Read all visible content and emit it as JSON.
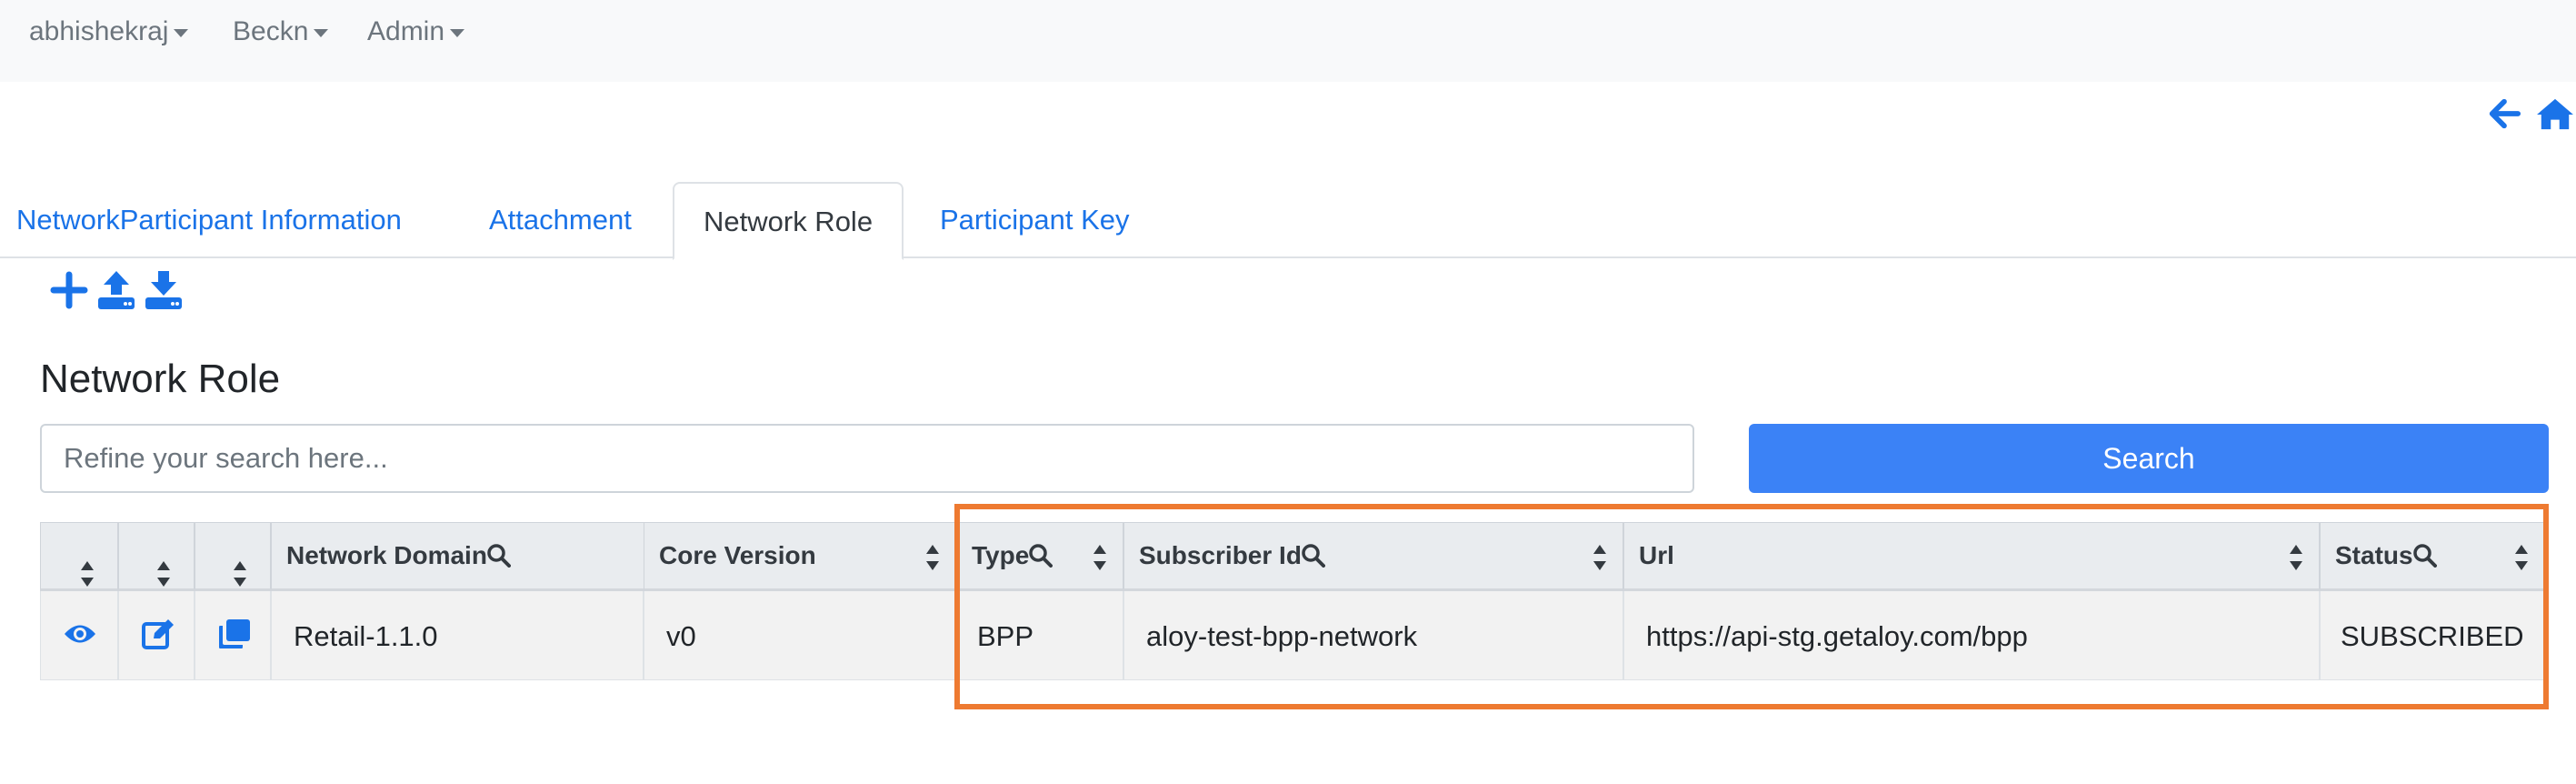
{
  "navbar": {
    "items": [
      {
        "label": "abhishekraj"
      },
      {
        "label": "Beckn"
      },
      {
        "label": "Admin"
      }
    ]
  },
  "tabs": [
    {
      "label": "NetworkParticipant Information",
      "active": false
    },
    {
      "label": "Attachment",
      "active": false
    },
    {
      "label": "Network Role",
      "active": true
    },
    {
      "label": "Participant Key",
      "active": false
    }
  ],
  "page": {
    "title": "Network Role"
  },
  "search": {
    "placeholder": "Refine your search here...",
    "value": "",
    "button_label": "Search"
  },
  "table": {
    "columns": [
      "",
      "",
      "",
      "Network Domain",
      "Core Version",
      "Type",
      "Subscriber Id",
      "Url",
      "Status"
    ],
    "searchable_columns": [
      "Network Domain",
      "Type",
      "Subscriber Id",
      "Status"
    ],
    "rows": [
      {
        "network_domain": "Retail-1.1.0",
        "core_version": "v0",
        "type": "BPP",
        "subscriber_id": "aloy-test-bpp-network",
        "url": "https://api-stg.getaloy.com/bpp",
        "status": "SUBSCRIBED"
      }
    ]
  },
  "colors": {
    "accent": "#1a73e8",
    "button": "#3b82f6",
    "highlight": "#ee7a31"
  },
  "icons": [
    "back-arrow-icon",
    "home-icon",
    "plus-icon",
    "upload-icon",
    "download-icon",
    "eye-icon",
    "edit-icon",
    "copy-icon",
    "search-icon",
    "sort-icon"
  ]
}
